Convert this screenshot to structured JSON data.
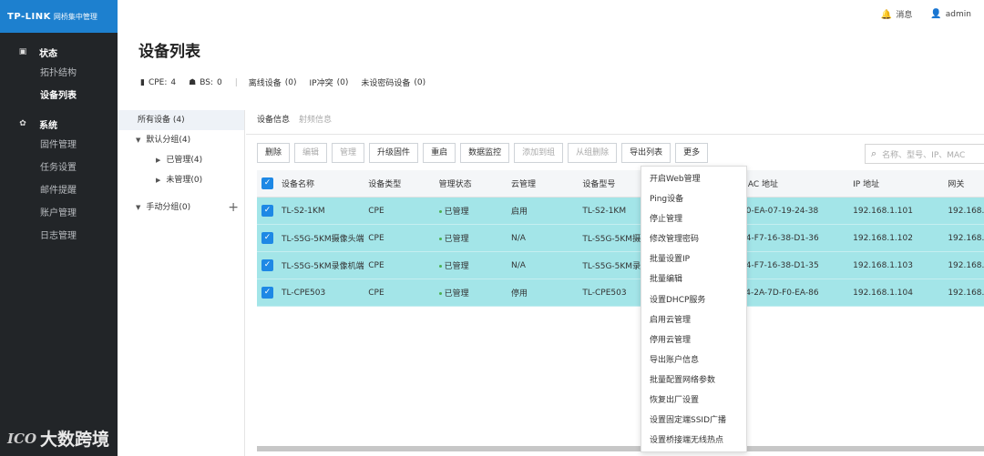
{
  "app": {
    "brand": "TP-LINK",
    "subtitle": "网桥集中管理"
  },
  "topbar": {
    "messages_label": "消息",
    "user_label": "admin"
  },
  "sidebar": {
    "groups": [
      {
        "label": "状态",
        "icon": "monitor-icon",
        "items": [
          "拓扑结构",
          "设备列表"
        ]
      },
      {
        "label": "系统",
        "icon": "gear-icon",
        "items": [
          "固件管理",
          "任务设置",
          "邮件提醒",
          "账户管理",
          "日志管理"
        ]
      }
    ],
    "active_item": "设备列表"
  },
  "page": {
    "title": "设备列表"
  },
  "summary": {
    "cpe_label": "CPE:",
    "cpe_count": "4",
    "bs_label": "BS:",
    "bs_count": "0",
    "offline_label": "离线设备",
    "offline_count": "(0)",
    "ipconflict_label": "IP冲突",
    "ipconflict_count": "(0)",
    "unpw_label": "未设密码设备",
    "unpw_count": "(0)"
  },
  "tree": {
    "all": "所有设备 (4)",
    "default_group": "默认分组(4)",
    "managed": "已管理(4)",
    "unmanaged": "未管理(0)",
    "manual_group": "手动分组(0)",
    "add_symbol": "+"
  },
  "tabs": [
    "设备信息",
    "射频信息"
  ],
  "toolbar": [
    "删除",
    "编辑",
    "管理",
    "升级固件",
    "重启",
    "数据监控",
    "添加到组",
    "从组删除",
    "导出列表",
    "更多"
  ],
  "toolbar_disabled": [
    1,
    2,
    6,
    7
  ],
  "search": {
    "placeholder": "名称、型号、IP、MAC"
  },
  "table": {
    "headers": [
      "设备名称",
      "设备类型",
      "管理状态",
      "云管理",
      "设备型号",
      "MAC 地址",
      "IP 地址",
      "网关"
    ],
    "rows": [
      {
        "name": "TL-S2-1KM",
        "type": "CPE",
        "status": "已管理",
        "cloud": "启用",
        "model": "TL-S2-1KM",
        "mac": "30-EA-07-19-24-38",
        "ip": "192.168.1.101",
        "gw": "192.168."
      },
      {
        "name": "TL-S5G-5KM摄像头端",
        "type": "CPE",
        "status": "已管理",
        "cloud": "N/A",
        "model": "TL-S5G-5KM摄",
        "mac": "34-F7-16-38-D1-36",
        "ip": "192.168.1.102",
        "gw": "192.168."
      },
      {
        "name": "TL-S5G-5KM录像机端",
        "type": "CPE",
        "status": "已管理",
        "cloud": "N/A",
        "model": "TL-S5G-5KM录",
        "mac": "34-F7-16-38-D1-35",
        "ip": "192.168.1.103",
        "gw": "192.168."
      },
      {
        "name": "TL-CPE503",
        "type": "CPE",
        "status": "已管理",
        "cloud": "停用",
        "model": "TL-CPE503",
        "mac": "F4-2A-7D-F0-EA-86",
        "ip": "192.168.1.104",
        "gw": "192.168."
      }
    ]
  },
  "more_menu": [
    "开启Web管理",
    "Ping设备",
    "停止管理",
    "修改管理密码",
    "批量设置IP",
    "批量编辑",
    "设置DHCP服务",
    "启用云管理",
    "停用云管理",
    "导出账户信息",
    "批量配置网络参数",
    "恢复出厂设置",
    "设置固定端SSID广播",
    "设置桥接端无线热点"
  ],
  "watermark": {
    "logo": "ICO",
    "text": "大数跨境"
  },
  "colors": {
    "sidebar_bg": "#222528",
    "logo_bg": "#1d80cf",
    "row_highlight": "#a3e5e8",
    "checkbox": "#1e88e5"
  }
}
